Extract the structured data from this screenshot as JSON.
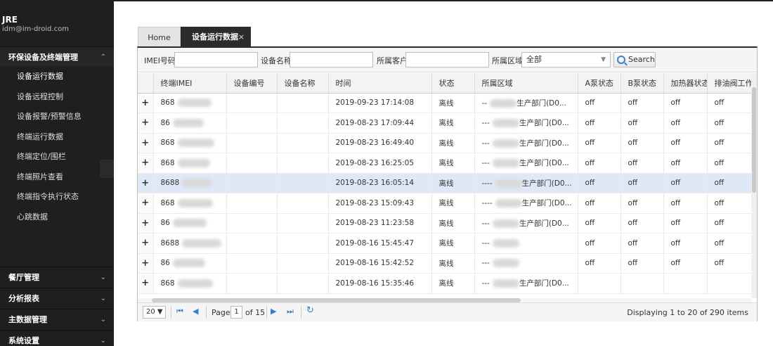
{
  "user": {
    "name": "JRE",
    "email": "idm@im-droid.com"
  },
  "sidebar": {
    "section_open": {
      "label": "环保设备及终端管理"
    },
    "items": [
      {
        "label": "设备运行数据"
      },
      {
        "label": "设备远程控制"
      },
      {
        "label": "设备报警/预警信息"
      },
      {
        "label": "终端运行数据"
      },
      {
        "label": "终端定位/围栏"
      },
      {
        "label": "终端照片查看"
      },
      {
        "label": "终端指令执行状态"
      },
      {
        "label": "心跳数据"
      }
    ],
    "sections_closed": [
      {
        "label": "餐厅管理"
      },
      {
        "label": "分析报表"
      },
      {
        "label": "主数据管理"
      },
      {
        "label": "系统设置"
      }
    ]
  },
  "tabs": [
    {
      "label": "Home"
    },
    {
      "label": "设备运行数据",
      "close": "×"
    }
  ],
  "filters": {
    "imei_label": "IMEI号码",
    "device_name_label": "设备名称",
    "customer_label": "所属客户",
    "region_label": "所属区域",
    "region_value": "全部",
    "search_label": "Search"
  },
  "columns": [
    "终端IMEI",
    "设备编号",
    "设备名称",
    "时间",
    "状态",
    "所属区域",
    "A泵状态",
    "B泵状态",
    "加热器状态",
    "排油阀工作"
  ],
  "rows": [
    {
      "imei": "868",
      "time": "2019-09-23 17:14:08",
      "status": "离线",
      "region": "--",
      "region_tail": "生产部门(D0...",
      "a": "off",
      "b": "off",
      "heater": "off",
      "valve": "off"
    },
    {
      "imei": "86",
      "time": "2019-08-23 17:09:44",
      "status": "离线",
      "region": "---",
      "region_tail": "生产部门(D0...",
      "a": "off",
      "b": "off",
      "heater": "off",
      "valve": "off"
    },
    {
      "imei": "868",
      "time": "2019-08-23 16:49:40",
      "status": "离线",
      "region": "---",
      "region_tail": "生产部门(D0...",
      "a": "off",
      "b": "off",
      "heater": "off",
      "valve": "off"
    },
    {
      "imei": "868",
      "time": "2019-08-23 16:25:05",
      "status": "离线",
      "region": "---",
      "region_tail": "生产部门(D0...",
      "a": "off",
      "b": "off",
      "heater": "off",
      "valve": "off"
    },
    {
      "imei": "8688",
      "time": "2019-08-23 16:05:14",
      "status": "离线",
      "region": "----",
      "region_tail": "生产部门(D0...",
      "a": "off",
      "b": "off",
      "heater": "off",
      "valve": "off"
    },
    {
      "imei": "868",
      "time": "2019-08-23 15:09:43",
      "status": "离线",
      "region": "----",
      "region_tail": "生产部门(D0...",
      "a": "off",
      "b": "off",
      "heater": "off",
      "valve": "off"
    },
    {
      "imei": "86",
      "time": "2019-08-23 11:23:58",
      "status": "离线",
      "region": "---",
      "region_tail": "生产部门(D0...",
      "a": "off",
      "b": "off",
      "heater": "off",
      "valve": "off"
    },
    {
      "imei": "8688",
      "time": "2019-08-16 15:45:47",
      "status": "离线",
      "region": "---",
      "region_tail": "",
      "a": "off",
      "b": "off",
      "heater": "off",
      "valve": "off"
    },
    {
      "imei": "86",
      "time": "2019-08-16 15:42:52",
      "status": "离线",
      "region": "---",
      "region_tail": "",
      "a": "off",
      "b": "off",
      "heater": "off",
      "valve": "off"
    },
    {
      "imei": "868",
      "time": "2019-08-16 15:35:46",
      "status": "离线",
      "region": "---",
      "region_tail": "生产部门(D0...",
      "a": "",
      "b": "",
      "heater": "",
      "valve": ""
    }
  ],
  "selected_row": 4,
  "expand_symbol": "+",
  "pager": {
    "page_size": "20 ▼",
    "page_label": "Page",
    "current_page": "1",
    "of_pages": "of 15",
    "display_msg": "Displaying 1 to 20 of 290 items"
  },
  "colors": {
    "sidebar_bg": "#1f1f1f",
    "active_tab": "#2b2b2b",
    "selected_row": "#dfe8f6",
    "pager_icon": "#3a7cc6"
  }
}
